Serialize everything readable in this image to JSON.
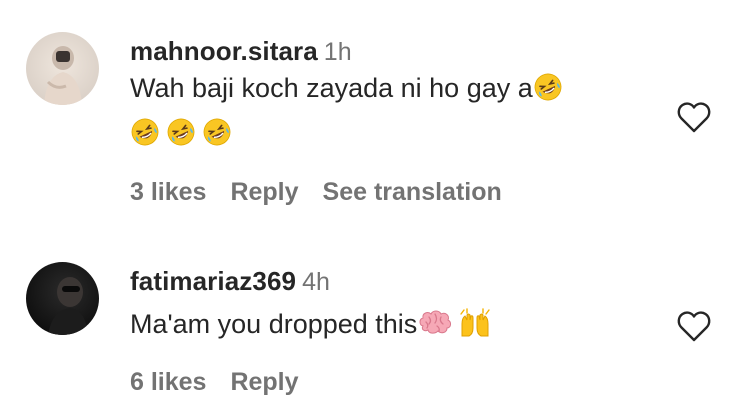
{
  "comments": [
    {
      "username": "mahnoor.sitara",
      "time": "1h",
      "text_line1": "Wah baji koch zayada ni ho gay a",
      "emoji_line1": [
        "rolling-on-floor-laughing"
      ],
      "emoji_line2": [
        "rolling-on-floor-laughing",
        "rolling-on-floor-laughing",
        "rolling-on-floor-laughing"
      ],
      "likes": "3 likes",
      "reply": "Reply",
      "translation": "See translation"
    },
    {
      "username": "fatimariaz369",
      "time": "4h",
      "text_line1": "Ma'am you dropped this",
      "emoji_line1": [
        "brain",
        "raising-hands"
      ],
      "likes": "6 likes",
      "reply": "Reply"
    }
  ],
  "icons": {
    "like": "heart-outline-icon"
  },
  "colors": {
    "text": "#262626",
    "secondary": "#737373",
    "background": "#ffffff"
  }
}
